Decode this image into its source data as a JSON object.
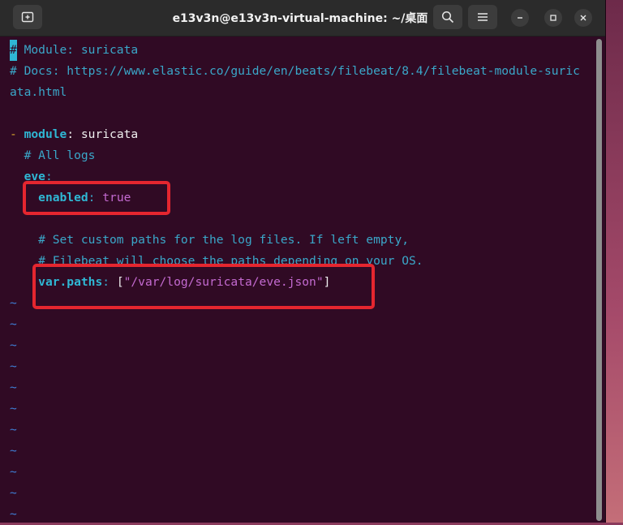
{
  "window": {
    "title": "e13v3n@e13v3n-virtual-machine: ~/桌面"
  },
  "titlebar": {
    "new_tab_icon": "new-tab-icon",
    "search_icon": "search-icon",
    "menu_icon": "hamburger-menu-icon",
    "minimize_icon": "minimize-icon",
    "maximize_icon": "maximize-icon",
    "close_icon": "close-icon"
  },
  "editor": {
    "cursor_char": "#",
    "line1_rest": " Module: suricata",
    "line2": "# Docs: https://www.elastic.co/guide/en/beats/filebeat/8.4/filebeat-module-suric",
    "line3": "ata.html",
    "line5_dash": "-",
    "line5_key": "module",
    "line5_colon": ": ",
    "line5_value": "suricata",
    "line6": "  # All logs",
    "line7_key": "eve",
    "line7_colon": ":",
    "line8_key": "enabled",
    "line8_colon": ": ",
    "line8_value": "true",
    "line10": "    # Set custom paths for the log files. If left empty,",
    "line11": "    # Filebeat will choose the paths depending on your OS.",
    "line12_key": "var.paths",
    "line12_colon": ": ",
    "line12_open": "[",
    "line12_value": "\"/var/log/suricata/eve.json\"",
    "line12_close": "]",
    "tilde": "~"
  },
  "colors": {
    "terminal_bg": "#300a24",
    "comment": "#3aa7c9",
    "key": "#2fb7d4",
    "string": "#c36ad0",
    "highlight_box": "#e5262f"
  }
}
